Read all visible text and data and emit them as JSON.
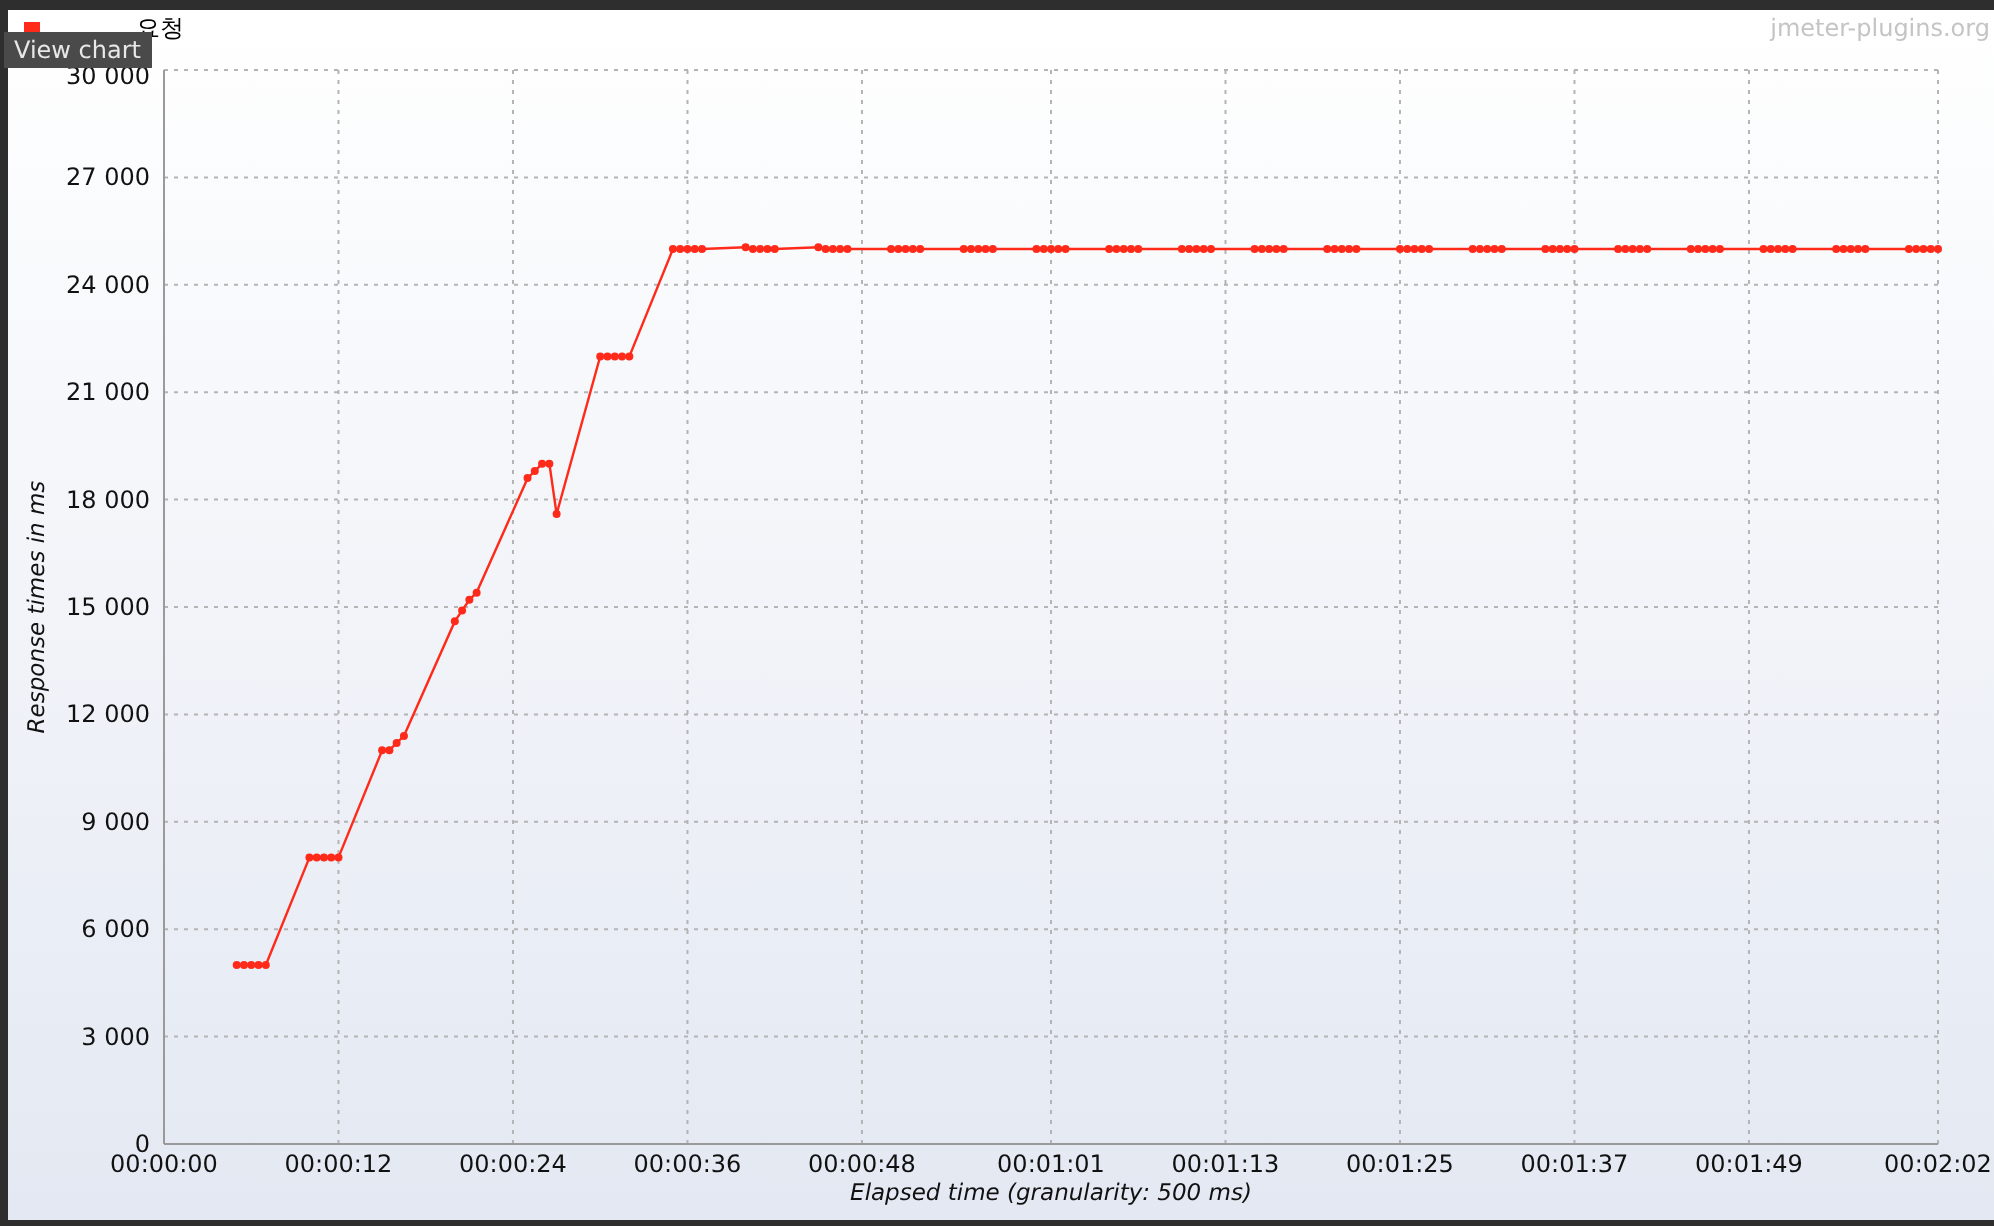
{
  "legend": {
    "color": "#ff2a1a"
  },
  "tooltip": "View chart",
  "watermark": "jmeter-plugins.org",
  "chart_data": {
    "type": "line",
    "xlabel": "Elapsed time (granularity: 500 ms)",
    "ylabel": "Response times in ms",
    "xlim": [
      0,
      122
    ],
    "ylim": [
      0,
      30000
    ],
    "grid": true,
    "xticks": [
      {
        "value": 0,
        "label": "00:00:00"
      },
      {
        "value": 12,
        "label": "00:00:12"
      },
      {
        "value": 24,
        "label": "00:00:24"
      },
      {
        "value": 36,
        "label": "00:00:36"
      },
      {
        "value": 48,
        "label": "00:00:48"
      },
      {
        "value": 61,
        "label": "00:01:01"
      },
      {
        "value": 73,
        "label": "00:01:13"
      },
      {
        "value": 85,
        "label": "00:01:25"
      },
      {
        "value": 97,
        "label": "00:01:37"
      },
      {
        "value": 109,
        "label": "00:01:49"
      },
      {
        "value": 122,
        "label": "00:02:02"
      }
    ],
    "yticks": [
      {
        "value": 0,
        "label": "0"
      },
      {
        "value": 3000,
        "label": "3 000"
      },
      {
        "value": 6000,
        "label": "6 000"
      },
      {
        "value": 9000,
        "label": "9 000"
      },
      {
        "value": 12000,
        "label": "12 000"
      },
      {
        "value": 15000,
        "label": "15 000"
      },
      {
        "value": 18000,
        "label": "18 000"
      },
      {
        "value": 21000,
        "label": "21 000"
      },
      {
        "value": 24000,
        "label": "24 000"
      },
      {
        "value": 27000,
        "label": "27 000"
      },
      {
        "value": 30000,
        "label": "30 000"
      }
    ],
    "x": [
      5,
      5.5,
      6,
      6.5,
      7,
      10,
      10.5,
      11,
      11.5,
      12,
      15,
      15.5,
      16,
      16.5,
      20,
      20.5,
      21,
      21.5,
      25,
      25.5,
      26,
      26.5,
      27,
      30,
      30.5,
      31,
      31.5,
      32,
      35,
      35.5,
      36,
      36.5,
      37,
      40,
      40.5,
      41,
      41.5,
      42,
      45,
      45.5,
      46,
      46.5,
      47,
      50,
      50.5,
      51,
      51.5,
      52,
      55,
      55.5,
      56,
      56.5,
      57,
      60,
      60.5,
      61,
      61.5,
      62,
      65,
      65.5,
      66,
      66.5,
      67,
      70,
      70.5,
      71,
      71.5,
      72,
      75,
      75.5,
      76,
      76.5,
      77,
      80,
      80.5,
      81,
      81.5,
      82,
      85,
      85.5,
      86,
      86.5,
      87,
      90,
      90.5,
      91,
      91.5,
      92,
      95,
      95.5,
      96,
      96.5,
      97,
      100,
      100.5,
      101,
      101.5,
      102,
      105,
      105.5,
      106,
      106.5,
      107,
      110,
      110.5,
      111,
      111.5,
      112,
      115,
      115.5,
      116,
      116.5,
      117,
      120,
      120.5,
      121,
      121.5,
      122
    ],
    "series": [
      {
        "name": "요청",
        "color": "#ff2a1a",
        "marker": "circle",
        "values": [
          5000,
          5000,
          5000,
          5000,
          5000,
          8000,
          8000,
          8000,
          8000,
          8000,
          11000,
          11000,
          11200,
          11400,
          14600,
          14900,
          15200,
          15400,
          18600,
          18800,
          19000,
          19000,
          17600,
          22000,
          22000,
          22000,
          22000,
          22000,
          25000,
          25000,
          25000,
          25000,
          25000,
          25050,
          25000,
          25000,
          25000,
          25000,
          25050,
          25000,
          25000,
          25000,
          25000,
          25000,
          25000,
          25000,
          25000,
          25000,
          25000,
          25000,
          25000,
          25000,
          25000,
          25000,
          25000,
          25000,
          25000,
          25000,
          25000,
          25000,
          25000,
          25000,
          25000,
          25000,
          25000,
          25000,
          25000,
          25000,
          25000,
          25000,
          25000,
          25000,
          25000,
          25000,
          25000,
          25000,
          25000,
          25000,
          25000,
          25000,
          25000,
          25000,
          25000,
          25000,
          25000,
          25000,
          25000,
          25000,
          25000,
          25000,
          25000,
          25000,
          25000,
          25000,
          25000,
          25000,
          25000,
          25000,
          25000,
          25000,
          25000,
          25000,
          25000,
          25000,
          25000,
          25000,
          25000,
          25000,
          25000,
          25000,
          25000,
          25000,
          25000,
          25000,
          25000,
          25000,
          25000,
          25000
        ]
      }
    ]
  }
}
